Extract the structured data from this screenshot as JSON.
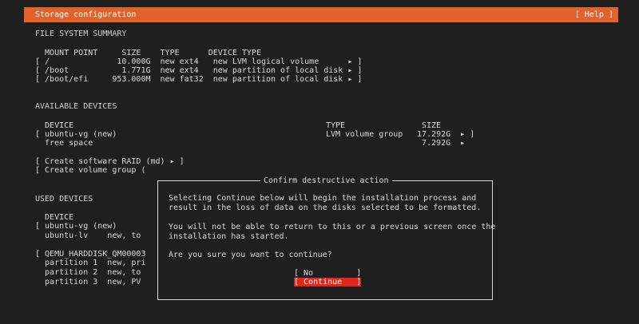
{
  "header": {
    "title": "Storage configuration",
    "help": "[ Help ]"
  },
  "fs_summary": {
    "title": "FILE SYSTEM SUMMARY",
    "columns": "  MOUNT POINT     SIZE    TYPE      DEVICE TYPE",
    "rows": [
      "[ /              10.000G  new ext4   new LVM logical volume      ▸ ]",
      "[ /boot           1.771G  new ext4   new partition of local disk ▸ ]",
      "[ /boot/efi     953.000M  new fat32  new partition of local disk ▸ ]"
    ]
  },
  "available": {
    "title": "AVAILABLE DEVICES",
    "col_device": "  DEVICE",
    "col_type": "TYPE",
    "col_size": "SIZE",
    "row1_device": "[ ubuntu-vg (new)",
    "row1_type": "LVM volume group",
    "row1_size": "17.292G  ▸ ]",
    "row2_device": "  free space",
    "row2_size": "7.292G  ▸",
    "raid": "[ Create software RAID (md) ▸ ]",
    "vg": "[ Create volume group ("
  },
  "used": {
    "title": "USED DEVICES",
    "lines": [
      "  DEVICE",
      "[ ubuntu-vg (new)",
      "  ubuntu-lv    new, to",
      "",
      "[ QEMU_HARDDISK_QM00003",
      "  partition 1  new, pri",
      "  partition 2  new, to",
      "  partition 3  new, PV"
    ]
  },
  "dialog": {
    "title": "Confirm destructive action",
    "line1": "Selecting Continue below will begin the installation process and",
    "line2": "result in the loss of data on the disks selected to be formatted.",
    "line3": "You will not be able to return to this or a previous screen once the",
    "line4": "installation has started.",
    "line5": "Are you sure you want to continue?",
    "no_label": "[ No         ]",
    "continue_label": "[ Continue   ]"
  }
}
